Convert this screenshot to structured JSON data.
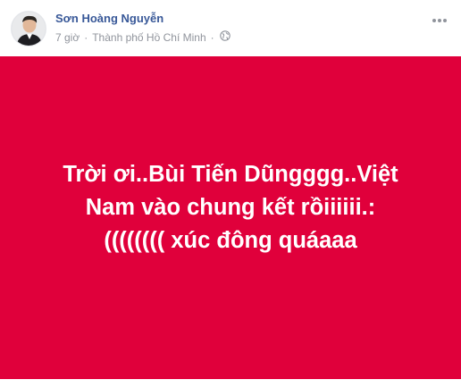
{
  "post": {
    "author_name": "Sơn Hoàng Nguyễn",
    "time": "7 giờ",
    "separator": "·",
    "location": "Thành phố Hồ Chí Minh",
    "privacy_icon": "globe-icon",
    "more_icon": "more-icon",
    "avatar_icon": "avatar",
    "banner": {
      "background_color": "#e0003b",
      "text_color": "#ffffff",
      "lines": [
        "Trời ơi..Bùi Tiến Dũngggg..Việt",
        "Nam vào chung kết rồiiiiii.:",
        "(((((((( xúc đông quáaaa"
      ]
    }
  }
}
